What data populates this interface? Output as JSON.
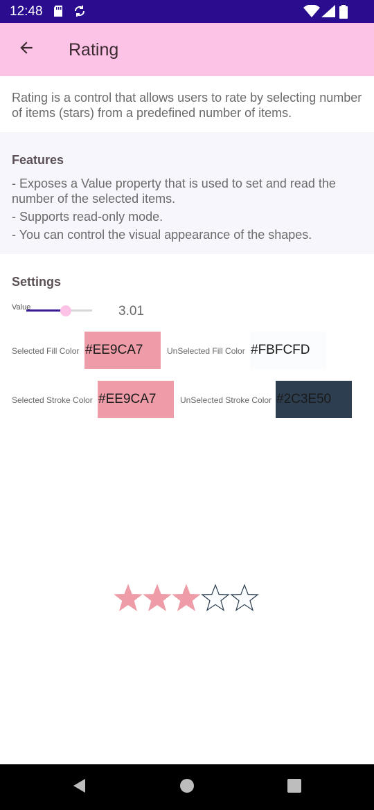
{
  "status_bar": {
    "time": "12:48",
    "icons": [
      "sd-card-icon",
      "sync-icon",
      "wifi-icon",
      "signal-icon",
      "battery-icon"
    ],
    "background": "#2a0d8f"
  },
  "app_bar": {
    "title": "Rating",
    "background": "#fdc3e6",
    "back_icon": "arrow-back-icon"
  },
  "intro": {
    "text": "Rating is a control that allows users to rate by selecting number of items (stars) from a predefined number of items."
  },
  "features": {
    "heading": "Features",
    "items": [
      "- Exposes a Value property that is used to set and read the number of the selected items.",
      "- Supports read-only mode.",
      "- You can control the visual appearance of the shapes."
    ]
  },
  "settings": {
    "heading": "Settings",
    "value_label": "Value",
    "value_text": "3.01",
    "slider_fraction": 0.6,
    "selected_fill_label": "Selected Fill Color",
    "selected_fill_value": "#EE9CA7",
    "unselected_fill_label": "UnSelected Fill Color",
    "unselected_fill_value": "#FBFCFD",
    "selected_stroke_label": "Selected Stroke Color",
    "selected_stroke_value": "#EE9CA7",
    "unselected_stroke_label": "UnSelected Stroke Color",
    "unselected_stroke_value": "#2C3E50"
  },
  "rating": {
    "item_count": 5,
    "value": 3.01,
    "selected_fill": "#EE9CA7",
    "unselected_fill": "#FBFCFD",
    "selected_stroke": "#EE9CA7",
    "unselected_stroke": "#2C3E50"
  },
  "nav_bar": {
    "icons": [
      "back-triangle-icon",
      "home-circle-icon",
      "recents-square-icon"
    ]
  }
}
